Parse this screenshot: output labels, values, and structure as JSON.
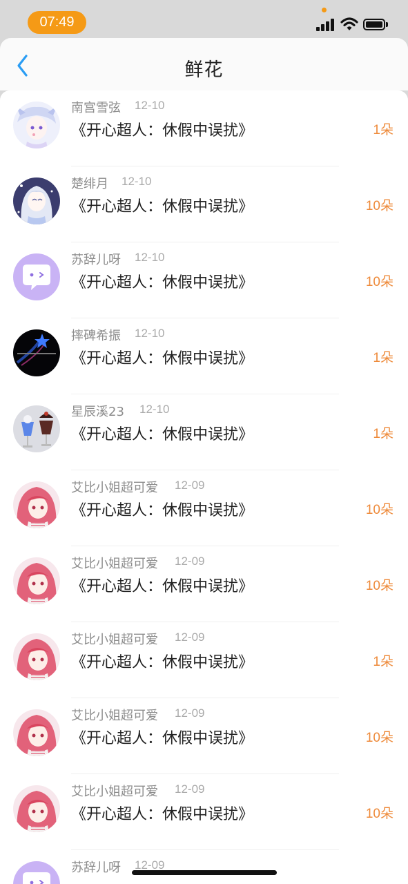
{
  "status": {
    "time": "07:49"
  },
  "header": {
    "title": "鲜花"
  },
  "items": [
    {
      "name": "南宫雪弦",
      "date": "12-10",
      "book": "《开心超人：休假中误扰》",
      "count": "1朵",
      "avatar": "anime-white-hair-icon"
    },
    {
      "name": "楚绯月",
      "date": "12-10",
      "book": "《开心超人：休假中误扰》",
      "count": "10朵",
      "avatar": "anime-silver-hair-icon"
    },
    {
      "name": "苏辞儿呀",
      "date": "12-10",
      "book": "《开心超人：休假中误扰》",
      "count": "10朵",
      "avatar": "chat-bubble-face-icon"
    },
    {
      "name": "摔碑希振",
      "date": "12-10",
      "book": "《开心超人：休假中误扰》",
      "count": "1朵",
      "avatar": "shooting-star-icon"
    },
    {
      "name": "星辰溪23",
      "date": "12-10",
      "book": "《开心超人：休假中误扰》",
      "count": "1朵",
      "avatar": "dessert-cups-icon"
    },
    {
      "name": "艾比小姐超可爱",
      "date": "12-09",
      "book": "《开心超人：休假中误扰》",
      "count": "10朵",
      "avatar": "anime-pink-hair-icon"
    },
    {
      "name": "艾比小姐超可爱",
      "date": "12-09",
      "book": "《开心超人：休假中误扰》",
      "count": "10朵",
      "avatar": "anime-pink-hair-icon"
    },
    {
      "name": "艾比小姐超可爱",
      "date": "12-09",
      "book": "《开心超人：休假中误扰》",
      "count": "1朵",
      "avatar": "anime-pink-hair-icon"
    },
    {
      "name": "艾比小姐超可爱",
      "date": "12-09",
      "book": "《开心超人：休假中误扰》",
      "count": "10朵",
      "avatar": "anime-pink-hair-icon"
    },
    {
      "name": "艾比小姐超可爱",
      "date": "12-09",
      "book": "《开心超人：休假中误扰》",
      "count": "10朵",
      "avatar": "anime-pink-hair-icon"
    },
    {
      "name": "苏辞儿呀",
      "date": "12-09",
      "book": "",
      "count": "",
      "avatar": "chat-bubble-face-icon"
    }
  ],
  "colors": {
    "accent": "#ee8a3a",
    "status_pill": "#f59a16",
    "back_arrow": "#2a9df4"
  }
}
